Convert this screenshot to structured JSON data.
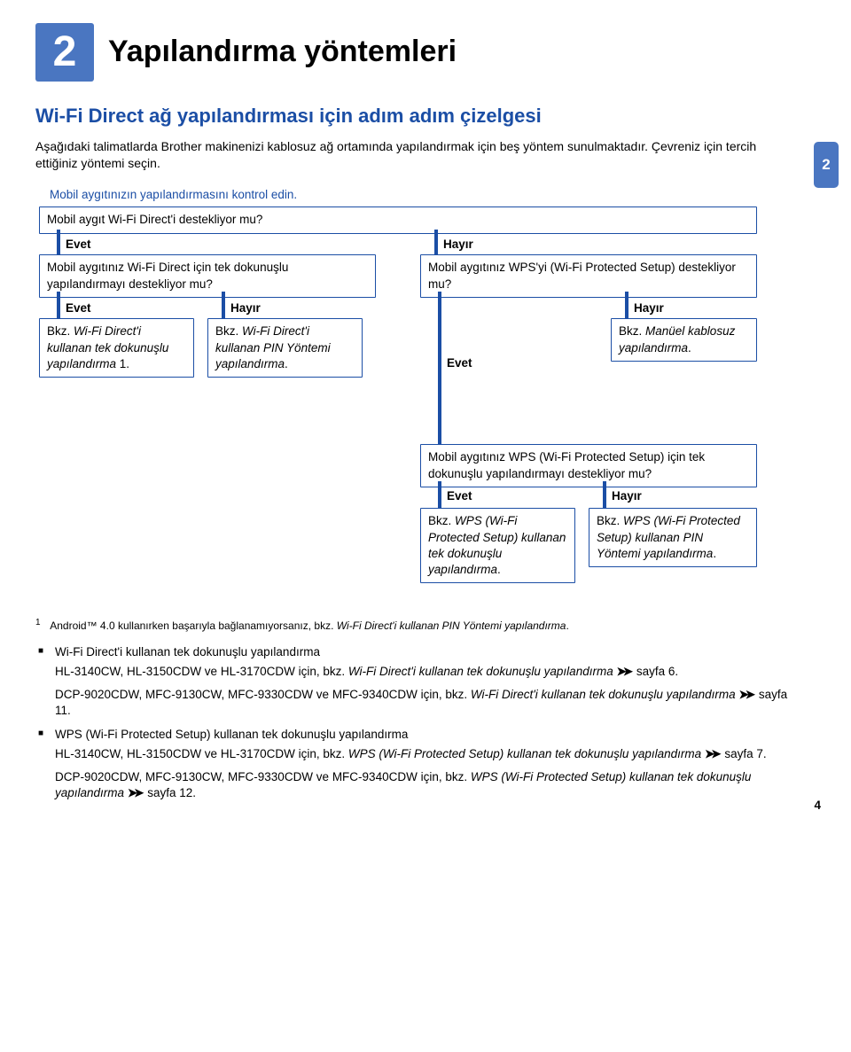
{
  "chapter": {
    "number": "2",
    "title": "Yapılandırma yöntemleri"
  },
  "side_tab": "2",
  "section_title": "Wi-Fi Direct ağ yapılandırması için adım adım çizelgesi",
  "intro": "Aşağıdaki talimatlarda Brother makinenizi kablosuz ağ ortamında yapılandırmak için beş yöntem sunulmaktadır. Çevreniz için tercih ettiğiniz yöntemi seçin.",
  "flowchart": {
    "start_text": "Mobil aygıtınızın yapılandırmasını kontrol edin.",
    "start_box": "Mobil aygıt Wi-Fi Direct'i destekliyor mu?",
    "yes": "Evet",
    "no": "Hayır",
    "box_left_q": "Mobil aygıtınız Wi-Fi Direct için tek dokunuşlu yapılandırmayı destekliyor mu?",
    "box_right_q": "Mobil aygıtınız WPS'yi (Wi-Fi Protected Setup) destekliyor mu?",
    "result_1_prefix": "Bkz. ",
    "result_1_italic": "Wi-Fi Direct'i kullanan tek dokunuşlu yapılandırma",
    "result_1_suffix": " 1.",
    "result_2_prefix": "Bkz. ",
    "result_2_italic": "Wi-Fi Direct'i kullanan PIN Yöntemi yapılandırma",
    "result_2_suffix": ".",
    "result_3_prefix": "Bkz. ",
    "result_3_italic": "Manüel kablosuz yapılandırma",
    "result_3_suffix": ".",
    "box_wps_q": "Mobil aygıtınız WPS (Wi-Fi Protected Setup) için tek dokunuşlu yapılandırmayı destekliyor mu?",
    "result_4_prefix": "Bkz. ",
    "result_4_italic": "WPS (Wi-Fi Protected Setup) kullanan tek dokunuşlu yapılandırma",
    "result_4_suffix": ".",
    "result_5_prefix": "Bkz. ",
    "result_5_italic": "WPS (Wi-Fi Protected Setup) kullanan PIN Yöntemi yapılandırma",
    "result_5_suffix": "."
  },
  "footnotes": {
    "f1_sup": "1",
    "f1_text_a": "Android™ 4.0 kullanırken başarıyla bağlanamıyorsanız, bkz. ",
    "f1_text_b": "Wi-Fi Direct'i kullanan PIN Yöntemi yapılandırma",
    "f1_text_c": ".",
    "bullet1_title": "Wi-Fi Direct'i kullanan tek dokunuşlu yapılandırma",
    "bullet1_p1_a": "HL-3140CW, HL-3150CDW ve HL-3170CDW için, bkz. ",
    "bullet1_p1_b": "Wi-Fi Direct'i kullanan tek dokunuşlu yapılandırma",
    "bullet1_p1_c": " sayfa 6.",
    "bullet1_p2_a": "DCP-9020CDW, MFC-9130CW, MFC-9330CDW ve MFC-9340CDW için, bkz. ",
    "bullet1_p2_b": "Wi-Fi Direct'i kullanan tek dokunuşlu yapılandırma",
    "bullet1_p2_c": " sayfa 11.",
    "bullet2_title": "WPS (Wi-Fi Protected Setup) kullanan tek dokunuşlu yapılandırma",
    "bullet2_p1_a": "HL-3140CW, HL-3150CDW ve HL-3170CDW için, bkz. ",
    "bullet2_p1_b": "WPS (Wi-Fi Protected Setup) kullanan tek dokunuşlu yapılandırma",
    "bullet2_p1_c": " sayfa 7.",
    "bullet2_p2_a": "DCP-9020CDW, MFC-9130CW, MFC-9330CDW ve MFC-9340CDW için, bkz. ",
    "bullet2_p2_b": "WPS (Wi-Fi Protected Setup) kullanan tek dokunuşlu yapılandırma",
    "bullet2_p2_c": " sayfa 12."
  },
  "page_number": "4",
  "arrows": "➤➤"
}
